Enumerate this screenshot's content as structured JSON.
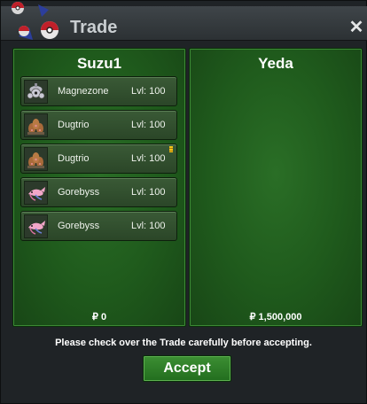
{
  "window": {
    "title": "Trade",
    "close_label": "✕"
  },
  "left_panel": {
    "player": "Suzu1",
    "money": "₽ 0",
    "pokemon": [
      {
        "name": "Magnezone",
        "level": "Lvl: 100",
        "icon": "magnezone-icon",
        "badge": false
      },
      {
        "name": "Dugtrio",
        "level": "Lvl: 100",
        "icon": "dugtrio-icon",
        "badge": false
      },
      {
        "name": "Dugtrio",
        "level": "Lvl: 100",
        "icon": "dugtrio-icon",
        "badge": true
      },
      {
        "name": "Gorebyss",
        "level": "Lvl: 100",
        "icon": "gorebyss-icon",
        "badge": false
      },
      {
        "name": "Gorebyss",
        "level": "Lvl: 100",
        "icon": "gorebyss-icon",
        "badge": false
      }
    ]
  },
  "right_panel": {
    "player": "Yeda",
    "money": "₽ 1,500,000",
    "pokemon": []
  },
  "footer": {
    "notice": "Please check over the Trade carefully before accepting.",
    "accept_label": "Accept"
  },
  "colors": {
    "panel_green": "#1f5a1c",
    "button_green": "#2f7d29",
    "badge_yellow": "#f3c41a"
  }
}
